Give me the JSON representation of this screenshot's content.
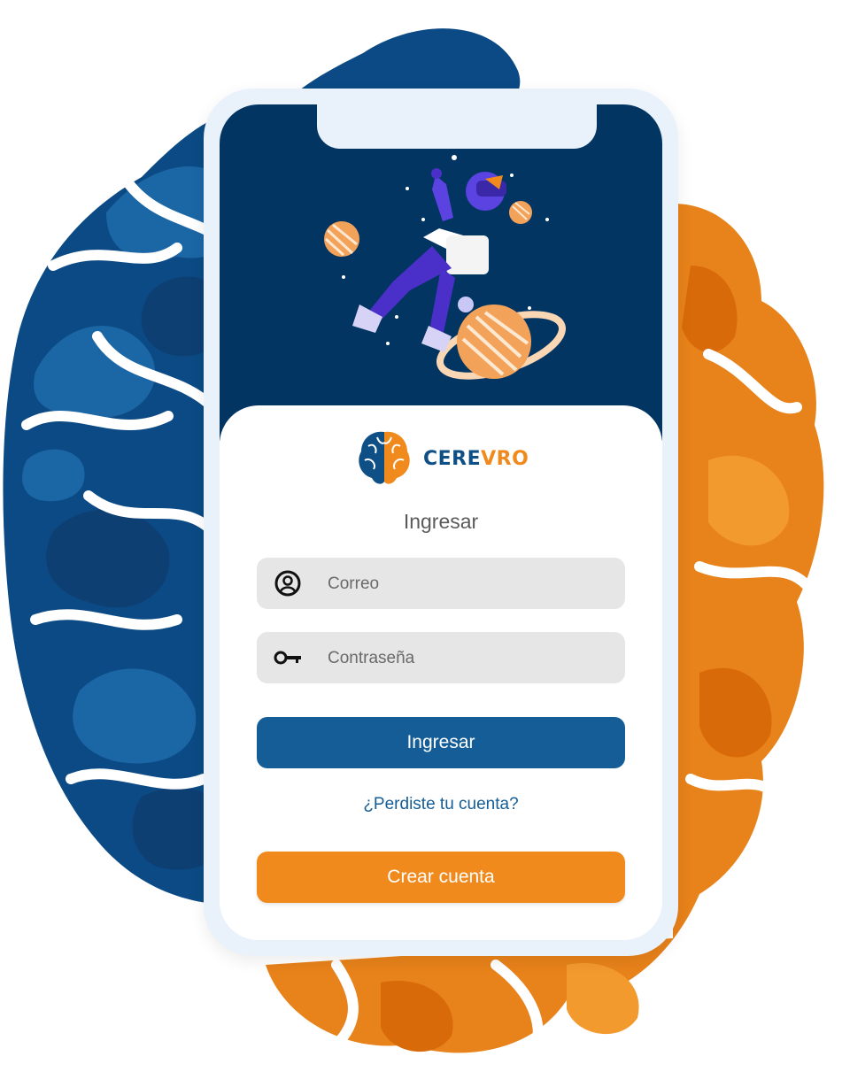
{
  "colors": {
    "brand_blue": "#145d96",
    "dark_navy": "#033562",
    "brand_orange": "#f08a1d",
    "field_bg": "#e6e6e6"
  },
  "brand": {
    "name_part1": "CERE",
    "name_part2": "VRO",
    "logo_icon": "brain-icon"
  },
  "login": {
    "heading": "Ingresar",
    "email_placeholder": "Correo",
    "email_icon": "user-circle-icon",
    "password_placeholder": "Contraseña",
    "password_icon": "key-icon",
    "submit_label": "Ingresar",
    "forgot_label": "¿Perdiste tu cuenta?",
    "create_label": "Crear cuenta"
  }
}
